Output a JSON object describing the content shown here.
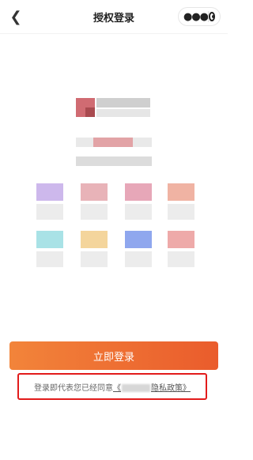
{
  "header": {
    "title": "授权登录",
    "back_icon": "back-chevron-icon",
    "more_icon": "more-dots-icon",
    "close_icon": "target-circle-icon"
  },
  "actions": {
    "login_label": "立即登录"
  },
  "agreement": {
    "prefix": "登录即代表您已经同意",
    "link_open": "《",
    "link_text": "隐私政策",
    "link_close": "》"
  },
  "colors": {
    "button_start": "#f2843a",
    "button_end": "#ea5c2c",
    "highlight_border": "#e21b1b"
  }
}
